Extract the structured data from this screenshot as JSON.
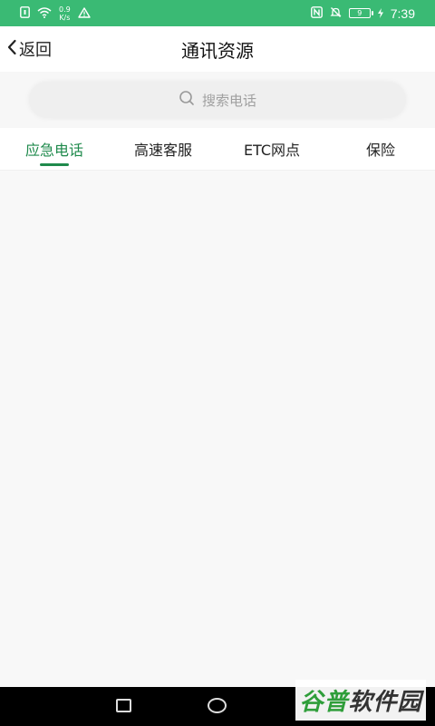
{
  "status_bar": {
    "net_speed_value": "0.9",
    "net_speed_unit": "K/s",
    "battery_level": "9",
    "time": "7:39"
  },
  "header": {
    "back_label": "返回",
    "title": "通讯资源"
  },
  "search": {
    "placeholder": "搜索电话"
  },
  "tabs": [
    {
      "label": "应急电话",
      "active": true
    },
    {
      "label": "高速客服",
      "active": false
    },
    {
      "label": "ETC网点",
      "active": false
    },
    {
      "label": "保险",
      "active": false
    }
  ],
  "watermark": {
    "text": "谷普软件园"
  },
  "colors": {
    "status_bar": "#3aba74",
    "accent": "#1f8a4c"
  }
}
